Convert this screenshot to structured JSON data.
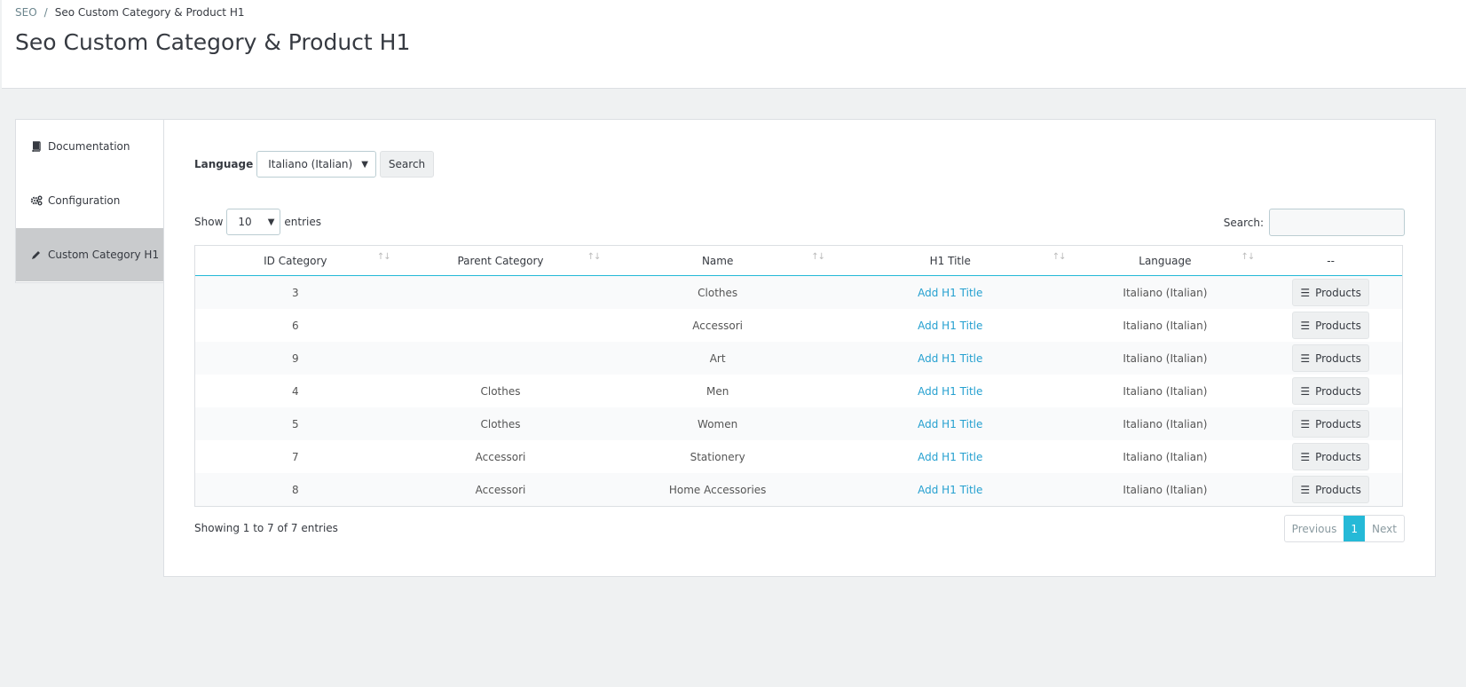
{
  "breadcrumb": {
    "root": "SEO",
    "separator": "/",
    "current": "Seo Custom Category & Product H1"
  },
  "page_title": "Seo Custom Category & Product H1",
  "sidebar": {
    "items": [
      {
        "label": "Documentation",
        "icon": "book-icon",
        "active": false
      },
      {
        "label": "Configuration",
        "icon": "cogs-icon",
        "active": false
      },
      {
        "label": "Custom Category H1",
        "icon": "pencil-icon",
        "active": true
      }
    ]
  },
  "language_filter": {
    "label": "Language",
    "selected": "Italiano (Italian)",
    "search_button": "Search"
  },
  "entries": {
    "show_label": "Show",
    "selected": "10",
    "suffix": "entries"
  },
  "table_search": {
    "label": "Search:",
    "value": ""
  },
  "table": {
    "columns": [
      "ID Category",
      "Parent Category",
      "Name",
      "H1 Title",
      "Language",
      "--"
    ],
    "rows": [
      {
        "id": "3",
        "parent": "",
        "name": "Clothes",
        "h1": "Add H1 Title",
        "language": "Italiano (Italian)",
        "action": "Products"
      },
      {
        "id": "6",
        "parent": "",
        "name": "Accessori",
        "h1": "Add H1 Title",
        "language": "Italiano (Italian)",
        "action": "Products"
      },
      {
        "id": "9",
        "parent": "",
        "name": "Art",
        "h1": "Add H1 Title",
        "language": "Italiano (Italian)",
        "action": "Products"
      },
      {
        "id": "4",
        "parent": "Clothes",
        "name": "Men",
        "h1": "Add H1 Title",
        "language": "Italiano (Italian)",
        "action": "Products"
      },
      {
        "id": "5",
        "parent": "Clothes",
        "name": "Women",
        "h1": "Add H1 Title",
        "language": "Italiano (Italian)",
        "action": "Products"
      },
      {
        "id": "7",
        "parent": "Accessori",
        "name": "Stationery",
        "h1": "Add H1 Title",
        "language": "Italiano (Italian)",
        "action": "Products"
      },
      {
        "id": "8",
        "parent": "Accessori",
        "name": "Home Accessories",
        "h1": "Add H1 Title",
        "language": "Italiano (Italian)",
        "action": "Products"
      }
    ]
  },
  "footer": {
    "info": "Showing 1 to 7 of 7 entries"
  },
  "pagination": {
    "previous": "Previous",
    "current": "1",
    "next": "Next"
  },
  "colors": {
    "accent": "#25b9d7",
    "link": "#25a0d0",
    "active_sidebar": "#c9cbcd"
  }
}
